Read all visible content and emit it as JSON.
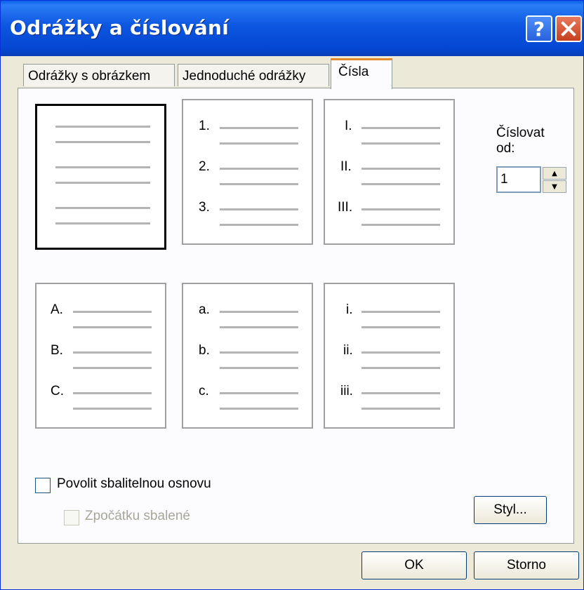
{
  "window": {
    "title": "Odrážky a číslování"
  },
  "tabs": [
    {
      "label": "Odrážky s obrázkem"
    },
    {
      "label": "Jednoduché odrážky"
    },
    {
      "label": "Čísla"
    }
  ],
  "presets": {
    "p1": [],
    "p2": [
      "1.",
      "2.",
      "3."
    ],
    "p3": [
      "I.",
      "II.",
      "III."
    ],
    "p4": [
      "A.",
      "B.",
      "C."
    ],
    "p5": [
      "a.",
      "b.",
      "c."
    ],
    "p6": [
      "i.",
      "ii.",
      "iii."
    ]
  },
  "start_at": {
    "label_line1": "Číslovat",
    "label_line2": "od:",
    "value": "1"
  },
  "options": {
    "collapsible": "Povolit sbalitelnou osnovu",
    "initially_collapsed": "Zpočátku sbalené"
  },
  "buttons": {
    "style": "Styl...",
    "ok": "OK",
    "cancel": "Storno"
  }
}
